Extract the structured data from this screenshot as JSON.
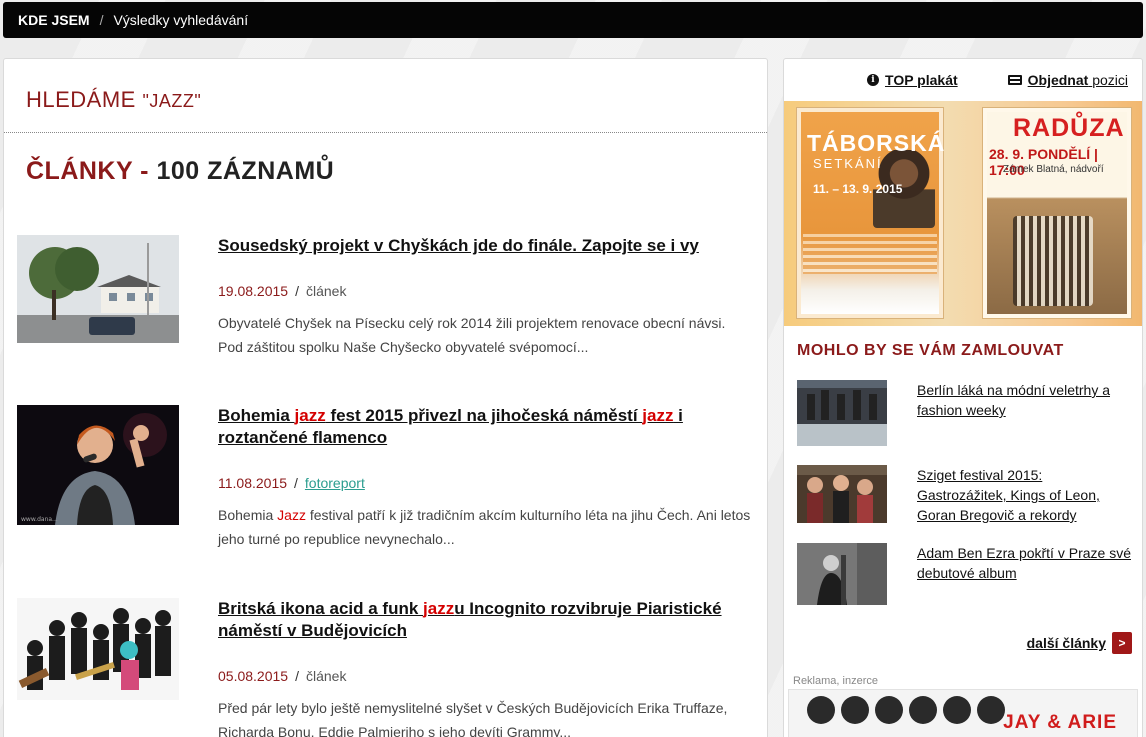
{
  "breadcrumb": {
    "home": "KDE JSEM",
    "separator": "/",
    "current": "Výsledky vyhledávání"
  },
  "search": {
    "prefix": "HLEDÁME",
    "query": "\"JAZZ\""
  },
  "section": {
    "name": "ČLÁNKY",
    "dash": "-",
    "count": "100 ZÁZNAMŮ"
  },
  "articles": [
    {
      "title_parts": [
        "Sousedský projekt v Chyškách jde do finále. Zapojte se i vy"
      ],
      "date": "19.08.2015",
      "type": "článek",
      "perex_parts": [
        "Obyvatelé Chyšek na Písecku celý rok 2014 žili projektem renovace obecní návsi. Pod záštitou spolku Naše Chyšecko obyvatelé svépomocí..."
      ]
    },
    {
      "title_parts": [
        "Bohemia ",
        "jazz",
        " fest 2015 přivezl na jihočeská náměstí ",
        "jazz",
        " i roztančené flamenco"
      ],
      "date": "11.08.2015",
      "type": "fotoreport",
      "perex_parts": [
        " Bohemia ",
        "Jazz",
        " festival patří k již tradičním akcím kulturního léta na jihu Čech. Ani letos jeho turné po republice nevynechalo..."
      ]
    },
    {
      "title_parts": [
        "Britská ikona acid a funk ",
        "jazz",
        "u Incognito rozvibruje Piaristické náměstí v Budějovicích"
      ],
      "date": "05.08.2015",
      "type": "článek",
      "perex_parts": [
        "Před pár lety bylo ještě nemyslitelné slyšet v Českých Budějovicích Erika Truffaze, Richarda Bonu, Eddie Palmieriho s jeho devíti Grammy..."
      ]
    }
  ],
  "sidebar": {
    "top_poster": "TOP plakát",
    "order_bold": "Objednat",
    "order_rest": "pozici",
    "poster1": {
      "title": "TÁBORSKÁ",
      "subtitle": "SETKÁNÍ",
      "dates": "11. – 13. 9. 2015"
    },
    "poster2": {
      "title": "RADŮZA",
      "dateline": "28. 9. PONDĚLÍ | 17:00",
      "place": "Zámek Blatná, nádvoří"
    },
    "heading": "MOHLO BY SE VÁM ZAMLOUVAT",
    "related": [
      "Berlín láká na módní veletrhy a fashion weeky",
      "Sziget festival 2015: Gastrozážitek, Kings of Leon, Goran Bregovič a rekordy",
      "Adam Ben Ezra pokřtí v Praze své debutové album"
    ],
    "more_label": "další články",
    "more_arrow": ">",
    "ad_label": "Reklama, inzerce",
    "ad_text": "JAY & ARIE"
  },
  "colors": {
    "brand_red": "#8b1a1a",
    "highlight": "#d40000",
    "link_teal": "#2a9d8f",
    "topbar": "#050505"
  }
}
